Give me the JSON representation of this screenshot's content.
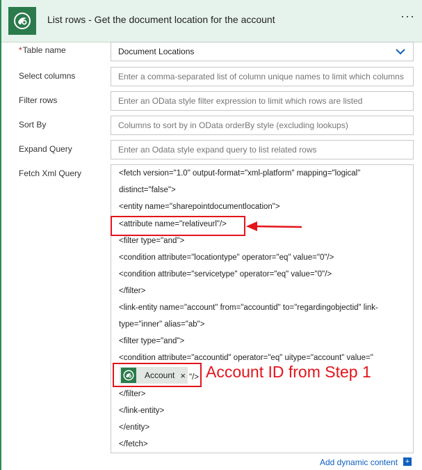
{
  "header": {
    "title": "List rows - Get the document location for the account",
    "more_icon": "ellipsis-icon"
  },
  "fields": {
    "table_name": {
      "label": "Table name",
      "required_marker": "*",
      "value": "Document Locations"
    },
    "select_columns": {
      "label": "Select columns",
      "placeholder": "Enter a comma-separated list of column unique names to limit which columns"
    },
    "filter_rows": {
      "label": "Filter rows",
      "placeholder": "Enter an OData style filter expression to limit which rows are listed"
    },
    "sort_by": {
      "label": "Sort By",
      "placeholder": "Columns to sort by in OData orderBy style (excluding lookups)"
    },
    "expand_query": {
      "label": "Expand Query",
      "placeholder": "Enter an Odata style expand query to list related rows"
    },
    "fetch_xml": {
      "label": "Fetch Xml Query",
      "lines": [
        "<fetch version=\"1.0\" output-format=\"xml-platform\" mapping=\"logical\"",
        "distinct=\"false\">",
        "<entity name=\"sharepointdocumentlocation\">",
        "<attribute name=\"relativeurl\"/>",
        "<filter type=\"and\">",
        "<condition attribute=\"locationtype\" operator=\"eq\" value=\"0\"/>",
        "<condition attribute=\"servicetype\" operator=\"eq\" value=\"0\"/>",
        "</filter>",
        "<link-entity name=\"account\" from=\"accountid\" to=\"regardingobjectid\" link-",
        "type=\"inner\" alias=\"ab\">",
        "<filter type=\"and\">",
        "<condition attribute=\"accountid\" operator=\"eq\" uitype=\"account\" value=\"",
        "\"/>",
        "</filter>",
        "</link-entity>",
        "</entity>",
        "</fetch>"
      ],
      "token": {
        "label": "Account",
        "close": "×"
      }
    }
  },
  "annotation": {
    "text": "Account ID from Step 1",
    "color": "#e3141c"
  },
  "footer": {
    "add_dynamic_content": "Add dynamic content",
    "plus": "+"
  },
  "colors": {
    "accent_green": "#2b7a4b",
    "header_bg": "#e6f3ec",
    "link_blue": "#0f5fbf"
  }
}
